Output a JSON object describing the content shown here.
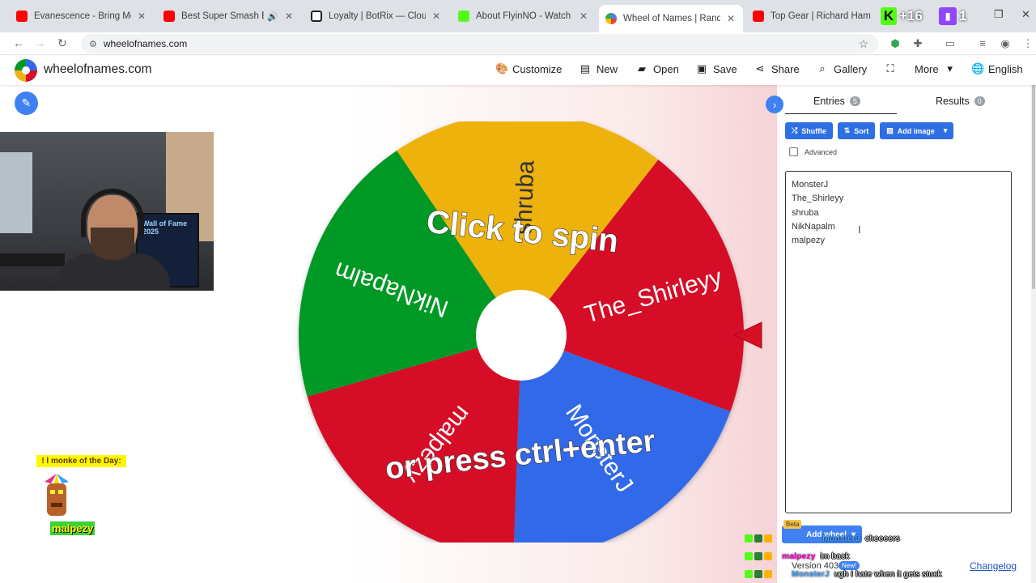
{
  "browser": {
    "tabs": [
      {
        "title": "Evanescence - Bring Me To Life",
        "favicon_color": "#ff0000"
      },
      {
        "title": "Best Super Smash Bros. Ulti",
        "favicon_color": "#ff0000"
      },
      {
        "title": "Loyalty | BotRix — Cloud Stream",
        "favicon_color": "#202124"
      },
      {
        "title": "About FlyinNO - Watch Live on",
        "favicon_color": "#53fc18"
      },
      {
        "title": "Wheel of Names | Random nam",
        "favicon_color": "#4285f4"
      },
      {
        "title": "Top Gear | Richard Hammond",
        "favicon_color": "#ff0000"
      }
    ],
    "ext_kick_count": "+16",
    "ext_twitch_count": "1",
    "url": "wheelofnames.com"
  },
  "header": {
    "site_name": "wheelofnames.com",
    "menu": {
      "customize": "Customize",
      "new": "New",
      "open": "Open",
      "save": "Save",
      "share": "Share",
      "gallery": "Gallery",
      "more": "More",
      "language": "English"
    }
  },
  "wheel": {
    "segments": [
      {
        "label": "shruba",
        "color": "#eeb211"
      },
      {
        "label": "The_Shirleyy",
        "color": "#d50f25"
      },
      {
        "label": "MonsterJ",
        "color": "#3369e8"
      },
      {
        "label": "malpezy",
        "color": "#d50f25"
      },
      {
        "label": "NikNapalm",
        "color": "#009925"
      }
    ],
    "prompt_top": "Click to spin",
    "prompt_bottom": "or press ctrl+enter"
  },
  "sidebar": {
    "tab_entries": "Entries",
    "entries_count": "5",
    "tab_results": "Results",
    "results_count": "0",
    "shuffle": "Shuffle",
    "sort": "Sort",
    "add_image": "Add image",
    "advanced": "Advanced",
    "entries": [
      "MonsterJ",
      "The_Shirleyy",
      "shruba",
      "NikNapalm",
      "malpezy"
    ],
    "add_wheel": "Add wheel",
    "beta": "Beta",
    "version": "Version 403",
    "new_tag": "New!",
    "changelog": "Changelog"
  },
  "overlay": {
    "monke_title": "! l monke of the Day:",
    "monke_name": "malpezy",
    "chat": [
      {
        "user": "MonsterJ",
        "message": "cheeeers"
      },
      {
        "user": "malpezy",
        "message": "im back"
      },
      {
        "user": "MonsterJ",
        "message": "ugh I hate when it gets stuck"
      }
    ],
    "cam_screen_text": "Wall of Fame 2025"
  }
}
